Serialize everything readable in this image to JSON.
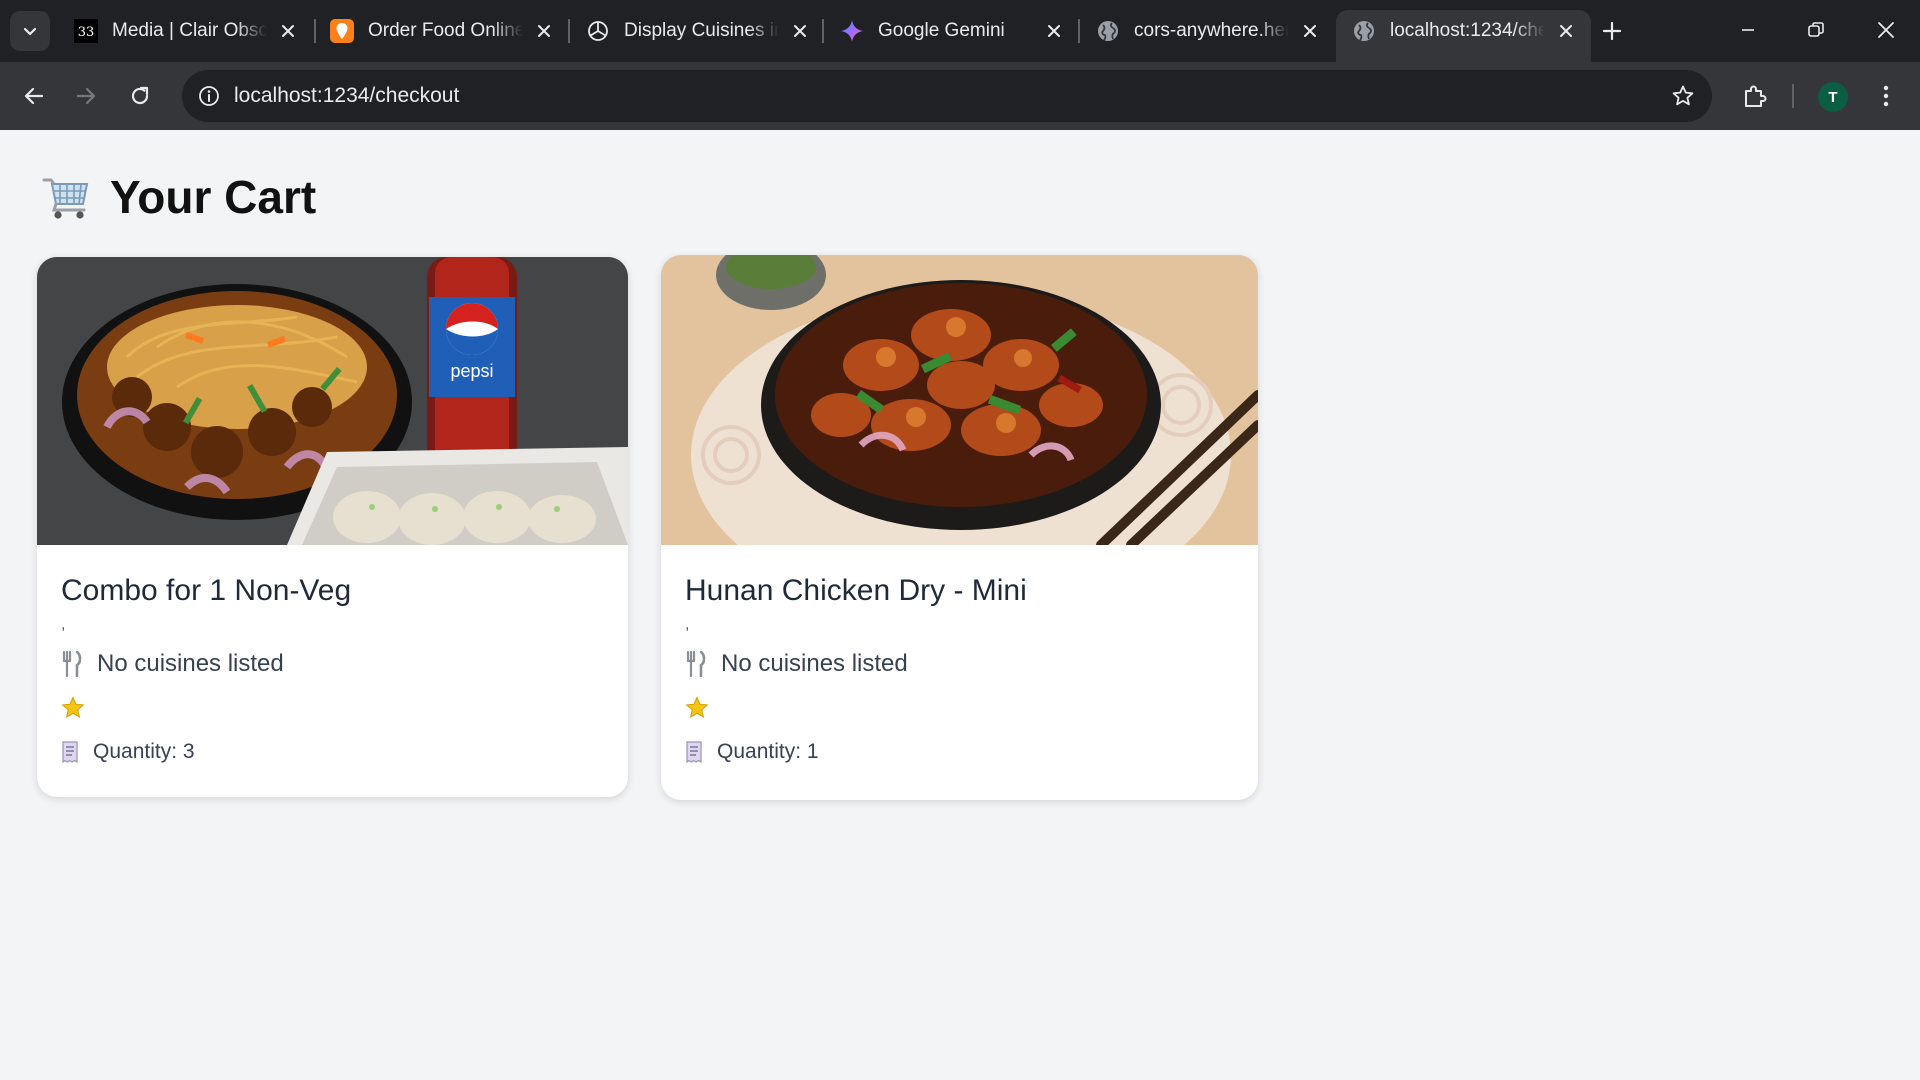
{
  "browser": {
    "tabs": [
      {
        "title": "Media | Clair Obscur",
        "favicon": "clair-obscur-33-icon"
      },
      {
        "title": "Order Food Online",
        "favicon": "swiggy-icon"
      },
      {
        "title": "Display Cuisines in",
        "favicon": "openai-icon"
      },
      {
        "title": "Google Gemini",
        "favicon": "gemini-icon"
      },
      {
        "title": "cors-anywhere.herokuapp.com",
        "favicon": "globe-icon"
      },
      {
        "title": "localhost:1234/checkout",
        "favicon": "globe-icon",
        "active": true
      }
    ],
    "url": "localhost:1234/checkout",
    "profile_initial": "T"
  },
  "page": {
    "title": "Your Cart",
    "title_icon": "shopping-cart-icon"
  },
  "cart": {
    "items": [
      {
        "name": "Combo for 1 Non-Veg",
        "comma": ",",
        "cuisines": "No cuisines listed",
        "rating_icon": "star-icon",
        "quantity": "Quantity: 3",
        "image": "noodles-manchurian-pepsi-momos-photo"
      },
      {
        "name": "Hunan Chicken Dry - Mini",
        "comma": ",",
        "cuisines": "No cuisines listed",
        "rating_icon": "star-icon",
        "quantity": "Quantity: 1",
        "image": "hunan-chicken-bowl-photo"
      }
    ]
  },
  "colors": {
    "page_bg": "#f3f4f6",
    "card_bg": "#ffffff",
    "chrome_dark": "#202124",
    "chrome_toolbar": "#35363a",
    "star": "#f5c518"
  }
}
